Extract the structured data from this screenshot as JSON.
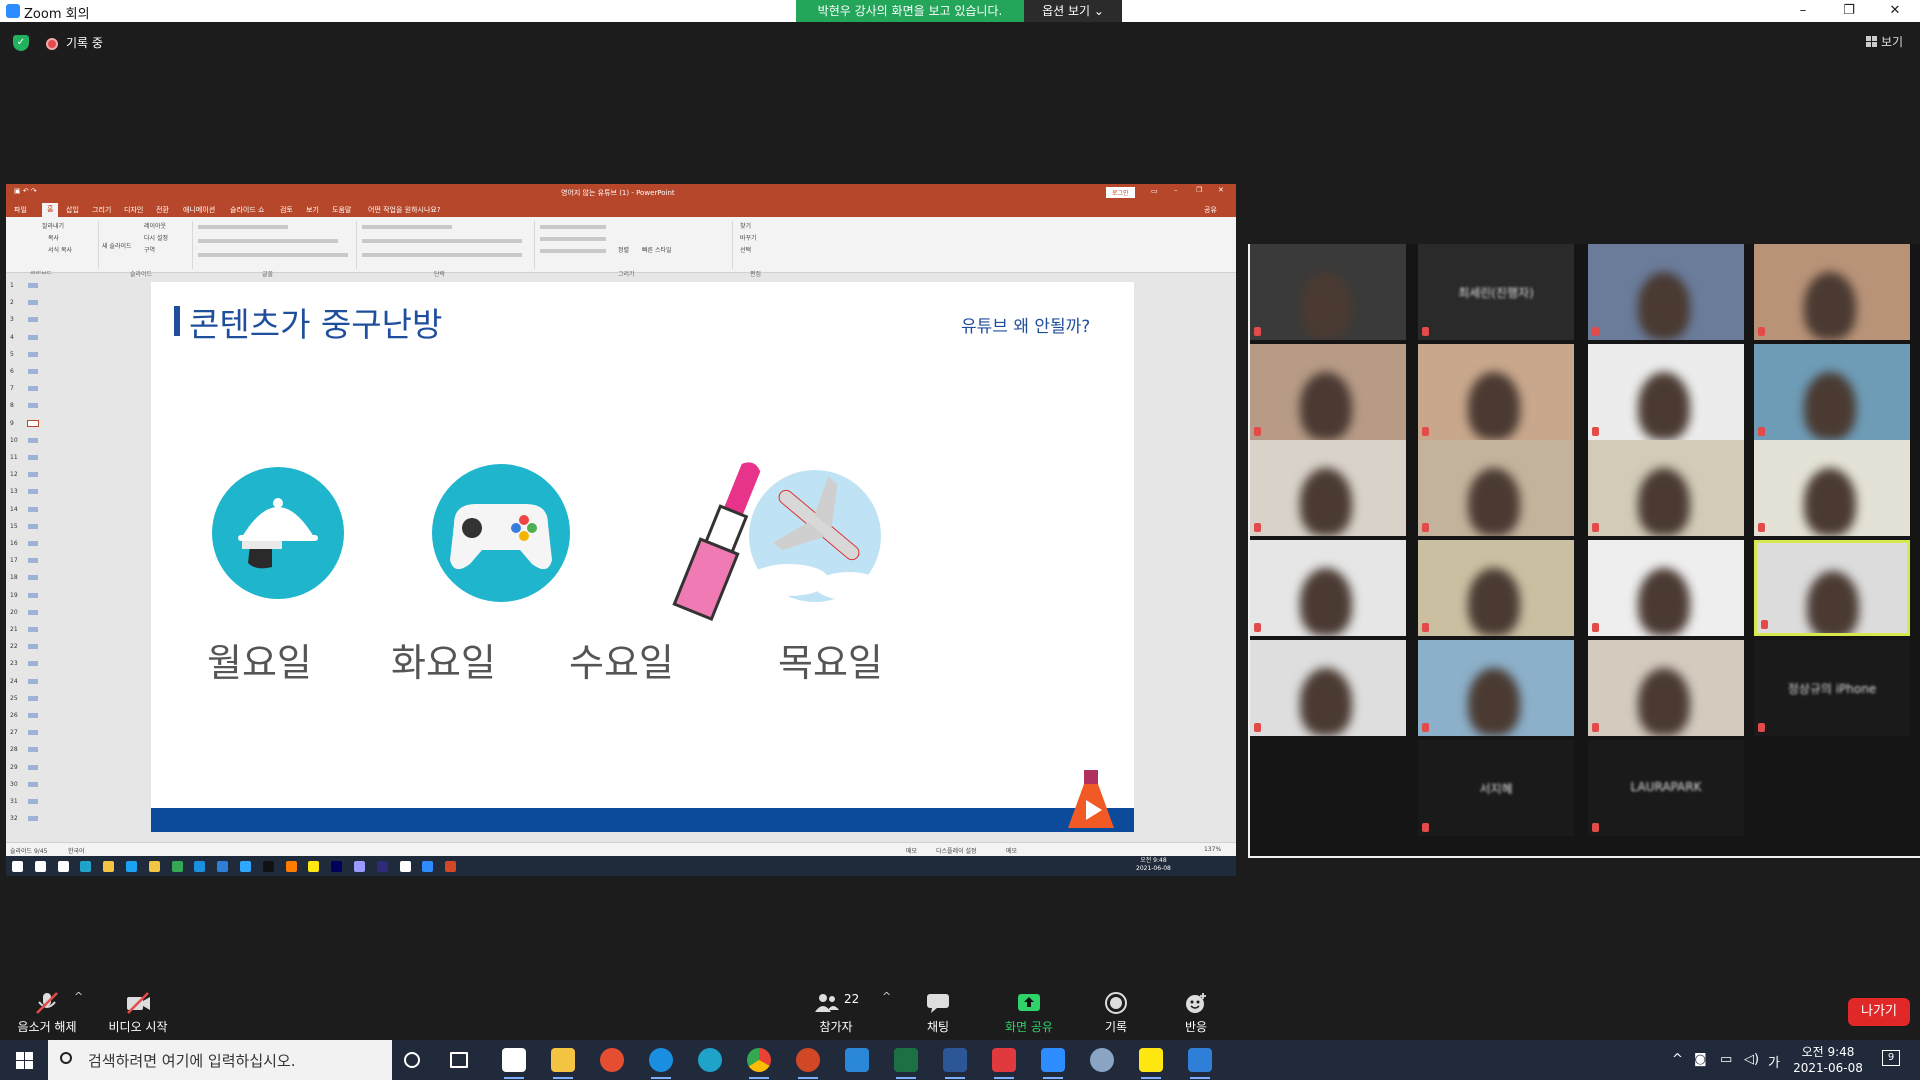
{
  "window": {
    "title": "Zoom 회의",
    "share_banner": "박현우 강사의 화면을 보고 있습니다.",
    "view_options": "옵션 보기 ⌄",
    "minimize": "–",
    "maximize": "❐",
    "close": "✕"
  },
  "topbar": {
    "recording_label": "기록 중",
    "view_label": "보기"
  },
  "powerpoint": {
    "doc_title": "영어지 않는 유튜브 (1)  -  PowerPoint",
    "signin": "로그인",
    "tabs": [
      "파일",
      "홈",
      "삽입",
      "그리기",
      "디자인",
      "전환",
      "애니메이션",
      "슬라이드 쇼",
      "검토",
      "보기",
      "도움말",
      "어떤 작업을 원하시나요?"
    ],
    "share": "공유",
    "ribbon_groups": [
      "클립보드",
      "슬라이드",
      "글꼴",
      "단락",
      "그리기",
      "편집"
    ],
    "ribbon_labels": [
      "잘라내기",
      "복사",
      "서식 복사",
      "새 슬라이드",
      "레이아웃",
      "다시 설정",
      "구역",
      "정렬",
      "빠른 스타일",
      "찾기",
      "바꾸기",
      "선택"
    ],
    "thumb_numbers": [
      "1",
      "2",
      "3",
      "4",
      "5",
      "6",
      "7",
      "8",
      "9",
      "10",
      "11",
      "12",
      "13",
      "14",
      "15",
      "16",
      "17",
      "18",
      "19",
      "20",
      "21",
      "22",
      "23",
      "24",
      "25",
      "26",
      "27",
      "28",
      "29",
      "30",
      "31",
      "32"
    ],
    "slide": {
      "title": "콘텐츠가 중구난방",
      "subtitle": "유튜브 왜 안될까?",
      "days": [
        "월요일",
        "화요일",
        "수요일",
        "목요일"
      ]
    },
    "status": {
      "slide_info": "슬라이드 9/45",
      "language": "한국어",
      "notes": "메모",
      "display": "디스플레이 설정",
      "comments": "메모",
      "zoom": "137%"
    },
    "inner_clock": {
      "time": "오전 9:48",
      "date": "2021-06-08"
    }
  },
  "gallery": {
    "name_tiles": [
      "최세린(진행자)",
      "정상규의 iPhone",
      "서지혜",
      "LAURAPARK"
    ]
  },
  "toolbar": {
    "mute": "음소거 해제",
    "video": "비디오 시작",
    "participants": "참가자",
    "participants_count": "22",
    "chat": "채팅",
    "share": "화면 공유",
    "record": "기록",
    "reactions": "반응",
    "leave": "나가기"
  },
  "taskbar": {
    "search_placeholder": "검색하려면 여기에 입력하십시오.",
    "time": "오전 9:48",
    "date": "2021-06-08",
    "ime": "가",
    "notifications": "9"
  }
}
